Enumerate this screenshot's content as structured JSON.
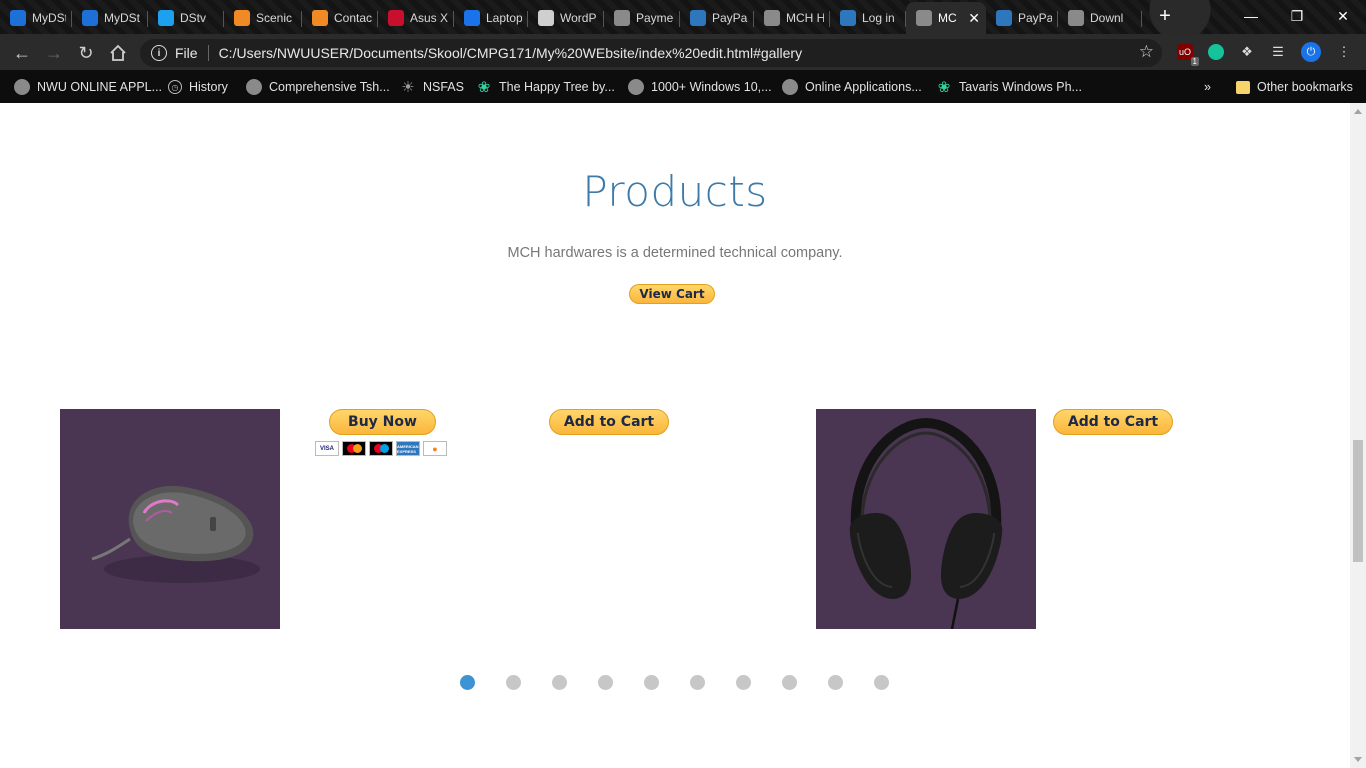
{
  "browser": {
    "tabs": [
      {
        "label": "MyDSt",
        "icon": "mydstv-icon",
        "color": "#1e6fd6"
      },
      {
        "label": "MyDSt",
        "icon": "mydstv-icon",
        "color": "#1e6fd6"
      },
      {
        "label": "DStv",
        "icon": "dstv-play-icon",
        "color": "#1ea0f0"
      },
      {
        "label": "Scenic",
        "icon": "t-icon",
        "color": "#f08a24"
      },
      {
        "label": "Contac",
        "icon": "t-icon",
        "color": "#f08a24"
      },
      {
        "label": "Asus X",
        "icon": "mcafee-icon",
        "color": "#c8102e"
      },
      {
        "label": "Laptop",
        "icon": "flag-icon",
        "color": "#1a73e8"
      },
      {
        "label": "WordP",
        "icon": "wordpress-icon",
        "color": "#cfcfcf"
      },
      {
        "label": "Payme",
        "icon": "globe-icon",
        "color": "#8a8a8a"
      },
      {
        "label": "PayPal",
        "icon": "paypal-icon",
        "color": "#2e77bc"
      },
      {
        "label": "MCH H",
        "icon": "globe-icon",
        "color": "#8a8a8a"
      },
      {
        "label": "Log in",
        "icon": "paypal-icon",
        "color": "#2e77bc"
      },
      {
        "label": "MC",
        "icon": "globe-icon",
        "color": "#8a8a8a",
        "active": true
      },
      {
        "label": "PayPal",
        "icon": "paypal-icon",
        "color": "#2e77bc"
      },
      {
        "label": "Downl",
        "icon": "download-icon",
        "color": "#8a8a8a"
      }
    ],
    "scheme": "File",
    "url": "C:/Users/NWUUSER/Documents/Skool/CMPG171/My%20WEbsite/index%20edit.html#gallery",
    "extension_badge": "1",
    "bookmarks": [
      {
        "label": "NWU ONLINE APPL...",
        "icon": "globe-icon"
      },
      {
        "label": "History",
        "icon": "history-icon"
      },
      {
        "label": "Comprehensive Tsh...",
        "icon": "globe-icon"
      },
      {
        "label": "NSFAS",
        "icon": "nsfas-icon"
      },
      {
        "label": "The Happy Tree by...",
        "icon": "leaf-icon"
      },
      {
        "label": "1000+ Windows 10,...",
        "icon": "globe-icon"
      },
      {
        "label": "Online Applications...",
        "icon": "globe-icon"
      },
      {
        "label": "Tavaris Windows Ph...",
        "icon": "leaf-icon"
      }
    ],
    "overflow": "»",
    "other_bookmarks": "Other bookmarks"
  },
  "page": {
    "title": "Products",
    "subtitle": "MCH hardwares is a determined technical company.",
    "view_cart_label": "View Cart",
    "buy_now_label": "Buy Now",
    "add_to_cart_label": "Add to Cart",
    "card_logos": [
      "VISA",
      "Mastercard",
      "Maestro",
      "AMERICAN EXPRESS",
      "DISCOVER"
    ],
    "carousel": {
      "slide_count": 10,
      "active_index": 0
    },
    "colors": {
      "title": "#3d7aa8",
      "image_bg": "#4a3553",
      "active_dot": "#3d93d4",
      "paypal_button": "#fbb63c"
    }
  }
}
